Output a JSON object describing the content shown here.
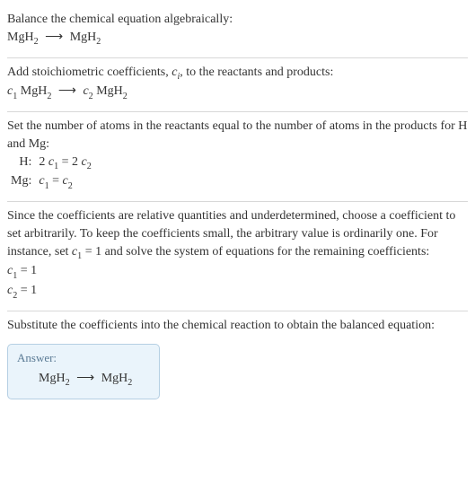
{
  "sections": {
    "s1": {
      "line1": "Balance the chemical equation algebraically:",
      "eq_lhs": "MgH",
      "eq_lhs_sub": "2",
      "arrow": "⟶",
      "eq_rhs": "MgH",
      "eq_rhs_sub": "2"
    },
    "s2": {
      "line1_a": "Add stoichiometric coefficients, ",
      "line1_var": "c",
      "line1_varsub": "i",
      "line1_b": ", to the reactants and products:",
      "c1": "c",
      "c1sub": "1",
      "sp1": " MgH",
      "sp1sub": "2",
      "arrow": "⟶",
      "c2": "c",
      "c2sub": "2",
      "sp2": " MgH",
      "sp2sub": "2"
    },
    "s3": {
      "line1": "Set the number of atoms in the reactants equal to the number of atoms in the products for H and Mg:",
      "rowH_label": "H:",
      "rowH_lhs_coef": "2 ",
      "rowH_lhs_var": "c",
      "rowH_lhs_sub": "1",
      "rowH_eq": " = ",
      "rowH_rhs_coef": "2 ",
      "rowH_rhs_var": "c",
      "rowH_rhs_sub": "2",
      "rowMg_label": "Mg:",
      "rowMg_lhs_var": "c",
      "rowMg_lhs_sub": "1",
      "rowMg_eq": " = ",
      "rowMg_rhs_var": "c",
      "rowMg_rhs_sub": "2"
    },
    "s4": {
      "para_a": "Since the coefficients are relative quantities and underdetermined, choose a coefficient to set arbitrarily. To keep the coefficients small, the arbitrary value is ordinarily one. For instance, set ",
      "para_var1": "c",
      "para_var1sub": "1",
      "para_b": " = 1 and solve the system of equations for the remaining coefficients:",
      "r1_var": "c",
      "r1_sub": "1",
      "r1_rest": " = 1",
      "r2_var": "c",
      "r2_sub": "2",
      "r2_rest": " = 1"
    },
    "s5": {
      "line1": "Substitute the coefficients into the chemical reaction to obtain the balanced equation:"
    },
    "answer": {
      "label": "Answer:",
      "lhs": "MgH",
      "lhs_sub": "2",
      "arrow": "⟶",
      "rhs": "MgH",
      "rhs_sub": "2"
    }
  }
}
